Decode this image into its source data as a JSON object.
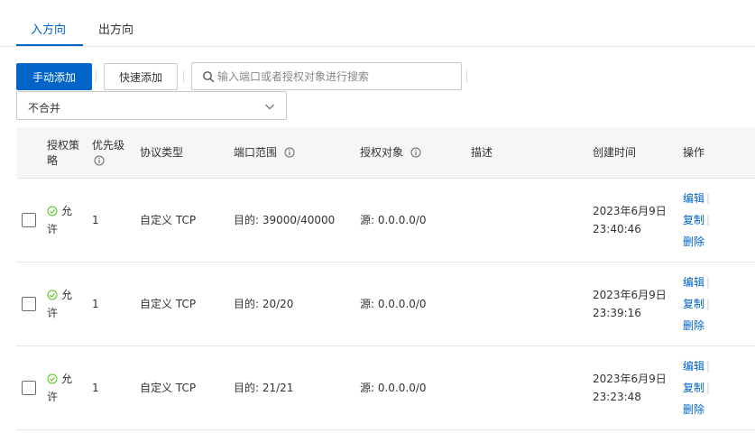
{
  "tabs": [
    {
      "label": "入方向",
      "active": true
    },
    {
      "label": "出方向",
      "active": false
    }
  ],
  "toolbar": {
    "manual_add_label": "手动添加",
    "quick_add_label": "快速添加",
    "search_placeholder": "输入端口或者授权对象进行搜索"
  },
  "merge_select": {
    "value": "不合并"
  },
  "table": {
    "headers": {
      "policy": "授权策略",
      "priority": "优先级",
      "protocol": "协议类型",
      "port_range": "端口范围",
      "auth_object": "授权对象",
      "description": "描述",
      "created": "创建时间",
      "actions": "操作"
    },
    "rows": [
      {
        "policy": "允许",
        "priority": "1",
        "protocol": "自定义 TCP",
        "port": "目的: 39000/40000",
        "source": "源: 0.0.0.0/0",
        "description": "",
        "date": "2023年6月9日",
        "time": "23:40:46"
      },
      {
        "policy": "允许",
        "priority": "1",
        "protocol": "自定义 TCP",
        "port": "目的: 20/20",
        "source": "源: 0.0.0.0/0",
        "description": "",
        "date": "2023年6月9日",
        "time": "23:39:16"
      },
      {
        "policy": "允许",
        "priority": "1",
        "protocol": "自定义 TCP",
        "port": "目的: 21/21",
        "source": "源: 0.0.0.0/0",
        "description": "",
        "date": "2023年6月9日",
        "time": "23:23:48"
      }
    ],
    "actions": {
      "edit": "编辑",
      "copy": "复制",
      "delete": "删除"
    }
  },
  "icons": {
    "search": "search-icon",
    "chevron": "chevron-down-icon",
    "info": "info-icon",
    "status": "check-circle-icon"
  },
  "colors": {
    "accent": "#0064c8",
    "allow": "#52c41a",
    "header_bg": "#f5f6f7"
  }
}
